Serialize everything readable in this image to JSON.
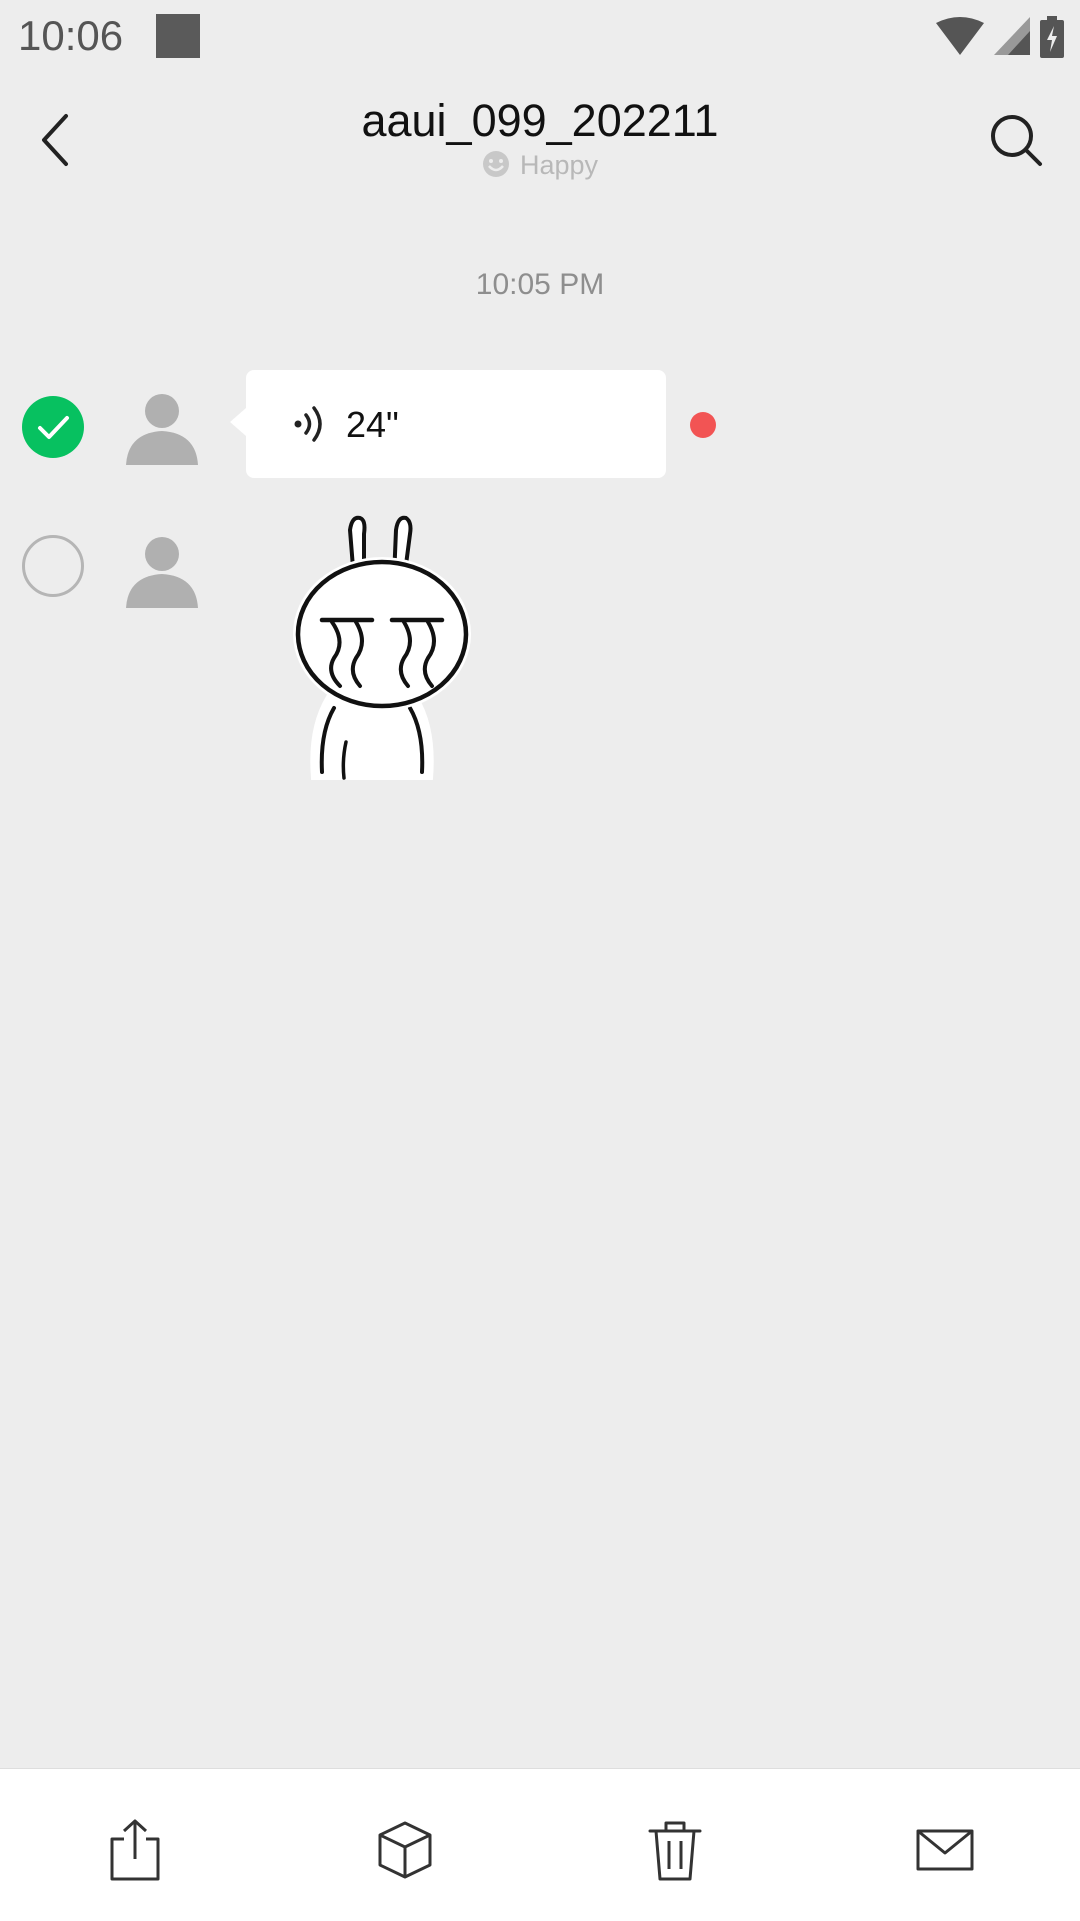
{
  "status_bar": {
    "time": "10:06",
    "icons": [
      "wifi-icon",
      "signal-icon",
      "battery-charging-icon"
    ]
  },
  "header": {
    "title": "aaui_099_202211",
    "status_text": "Happy",
    "status_icon": "smiley-icon",
    "back_icon": "back-arrow-icon",
    "search_icon": "search-icon"
  },
  "chat": {
    "timestamp": "10:05 PM",
    "messages": [
      {
        "type": "voice",
        "duration": "24\"",
        "selected": true,
        "unread": true
      },
      {
        "type": "sticker",
        "sticker": "crying-rabbit-sticker",
        "selected": false
      }
    ]
  },
  "toolbar": {
    "actions": [
      "share-icon",
      "box-icon",
      "trash-icon",
      "mail-icon"
    ]
  },
  "colors": {
    "background": "#ededed",
    "accent_green": "#07c160",
    "unread_red": "#f25454"
  }
}
